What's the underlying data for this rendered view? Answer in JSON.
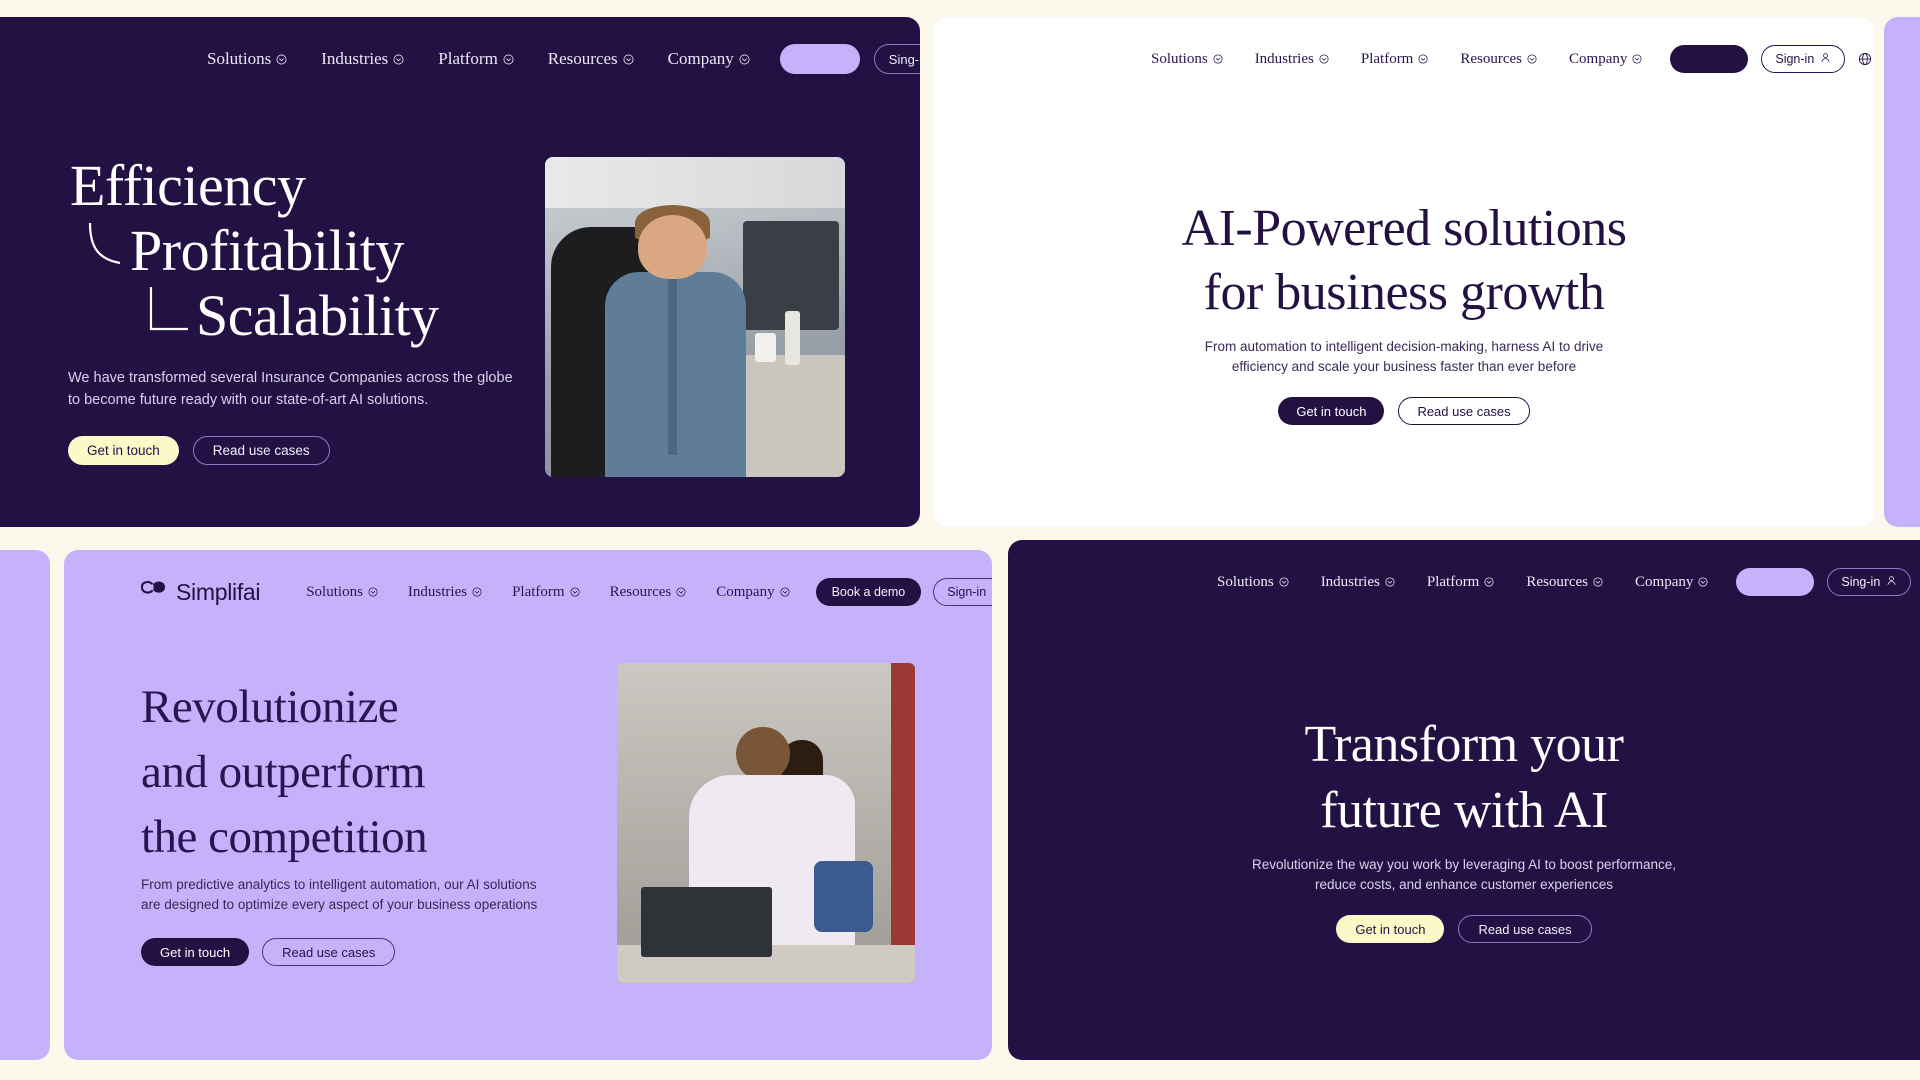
{
  "page": {
    "background_color": "#FDF8EC",
    "brand_name": "Simplifai"
  },
  "nav": {
    "items": [
      {
        "label": "Solutions",
        "has_dropdown": true
      },
      {
        "label": "Industries",
        "has_dropdown": true
      },
      {
        "label": "Platform",
        "has_dropdown": true
      },
      {
        "label": "Resources",
        "has_dropdown": true
      },
      {
        "label": "Company",
        "has_dropdown": true
      }
    ],
    "icons": {
      "globe": "globe-icon",
      "search": "search-icon",
      "user": "user-icon",
      "caret": "chevron-down-icon"
    }
  },
  "cards": [
    {
      "id": "card1",
      "theme": "dark-purple",
      "background_color": "#241144",
      "nav": {
        "cta_label": "",
        "signin_label": "Sing-in"
      },
      "hero": {
        "heading_lines": [
          "Efficiency",
          "Profitability",
          "Scalability"
        ],
        "paragraph_lines": [
          "We have transformed several Insurance Companies across the globe",
          "to become future ready with our state-of-art AI solutions."
        ],
        "primary_button": "Get in touch",
        "secondary_button": "Read use cases",
        "primary_button_color": "#FAFAC8",
        "image_alt": "man-at-desk-photo"
      }
    },
    {
      "id": "card2",
      "theme": "white",
      "background_color": "#FFFFFF",
      "nav": {
        "cta_label": "",
        "signin_label": "Sign-in"
      },
      "hero": {
        "heading_lines": [
          "AI-Powered solutions",
          "for business growth"
        ],
        "paragraph_lines": [
          "From automation to intelligent decision-making, harness AI to drive",
          "efficiency and scale your business faster than ever before"
        ],
        "primary_button": "Get in touch",
        "secondary_button": "Read use cases",
        "primary_button_color": "#241144"
      }
    },
    {
      "id": "card3",
      "theme": "lavender",
      "background_color": "#C6B2FA",
      "nav": {
        "logo_text": "Simplifai",
        "cta_label": "Book a demo",
        "signin_label": "Sign-in"
      },
      "hero": {
        "heading_lines": [
          "Revolutionize",
          "and outperform",
          "the competition"
        ],
        "paragraph_lines": [
          "From predictive analytics to intelligent automation, our AI solutions",
          "are designed to optimize every aspect of your business operations"
        ],
        "primary_button": "Get in touch",
        "secondary_button": "Read use cases",
        "primary_button_color": "#241144",
        "image_alt": "woman-with-laptop-photo"
      }
    },
    {
      "id": "card4",
      "theme": "dark-purple",
      "background_color": "#241144",
      "nav": {
        "cta_label": "",
        "signin_label": "Sing-in"
      },
      "hero": {
        "heading_lines": [
          "Transform your",
          "future with AI"
        ],
        "paragraph_lines": [
          "Revolutionize the way you work by leveraging AI to boost performance,",
          "reduce costs, and enhance customer experiences"
        ],
        "primary_button": "Get in touch",
        "secondary_button": "Read use cases",
        "primary_button_color": "#FAFAC8"
      }
    }
  ]
}
